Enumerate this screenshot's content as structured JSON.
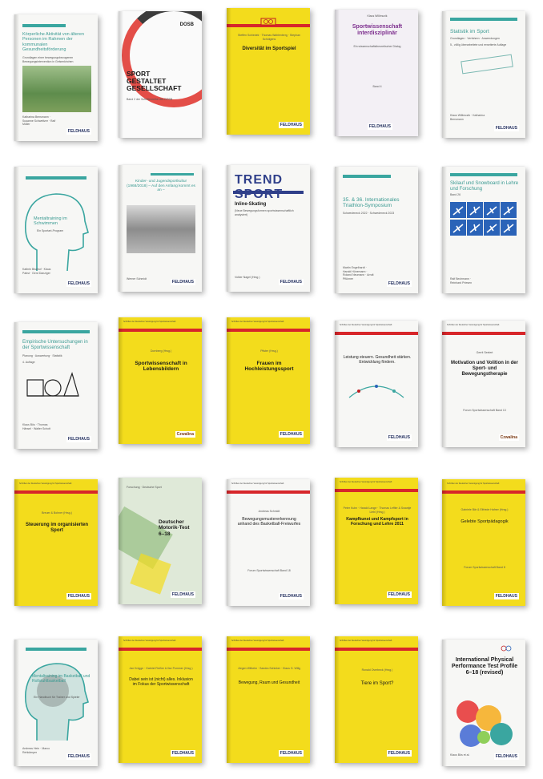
{
  "books": [
    {
      "title": "Körperliche Aktivität von älteren Personen im Rahmen der kommunalen Gesundheitsförderung",
      "subtitle": "Grundlagen einer bewegungsbezogenen Bewegungsintervention in Gelsenkirchen",
      "authors": "Katharina Bensmann · Susanne Schweitzer · Ralf Müller",
      "publisher": "FELDHAUS"
    },
    {
      "brand": "DOSB",
      "title": "SPORT GESTALTET GESELLSCHAFT",
      "subtitle": "Band 2 der Schriftenreihe des DOSB"
    },
    {
      "authors": "Steffen Schiedek · Thomas Wahlenberg · Stephan Schütgens",
      "title": "Diversität im Sportspiel",
      "publisher": "FELDHAUS"
    },
    {
      "author_top": "Klaus Willimczik",
      "title": "Sportwissenschaft interdisziplinär",
      "subtitle": "Ein wissenschaftstheoretischer Dialog",
      "band": "Band 4",
      "publisher": "FELDHAUS"
    },
    {
      "title": "Statistik im Sport",
      "subtitle": "Grundlagen · Verfahren · Anwendungen",
      "edition": "5., völlig überarbeitete und erweiterte Auflage",
      "authors": "Klaus Willimczik · Katharina Bensmann",
      "publisher": "FELDHAUS"
    },
    {
      "title": "Mentaltraining im Schwimmen",
      "subtitle": "Ein Sportart-Program",
      "authors": "Kathrin Bischof · Klaus Pabst · Gerd Danziger",
      "publisher": "FELDHAUS"
    },
    {
      "title": "Kinder- und Jugendsportkultur (1968/2018) – Auf den Anfang kommt es an –",
      "authors": "Werner Schmidt",
      "publisher": "FELDHAUS"
    },
    {
      "brand": "TREND SPORT",
      "title": "Inline-Skating",
      "subtitle": "(Neue Bewegungsformen sportwissenschaftlich analysiert)",
      "authors": "Volker Nagel (Hrsg.)",
      "publisher": "FELDHAUS"
    },
    {
      "title": "35. & 36. Internationales Triathlon-Symposium",
      "subtitle": "Schwedeneck 2022 · Schwedeneck 2023",
      "authors": "Martin Engelhardt · Harald Hünemann · Roland Neumann · Arndt Pfützner",
      "publisher": "FELDHAUS"
    },
    {
      "title": "Skilauf und Snowboard in Lehre und Forschung",
      "band": "Band 26",
      "authors": "Ralf Bechmann · Reinhard Priesen",
      "publisher": "FELDHAUS"
    },
    {
      "title": "Empirische Untersuchungen in der Sportwissenschaft",
      "subtitle": "Planung · Auswertung · Statistik",
      "edition": "4. Auflage",
      "authors": "Klaus Bös · Thomas Hänsel · Walter Schott",
      "publisher": "FELDHAUS"
    },
    {
      "series": "Schriften der Deutschen Vereinigung für Sportwissenschaft",
      "authors": "Dornberg (Hrsg.)",
      "title": "Sportwissenschaft in Lebensbildern",
      "publisher": "Czwalina"
    },
    {
      "series": "Schriften der Deutschen Vereinigung für Sportwissenschaft",
      "authors": "Pfister (Hrsg.)",
      "title": "Frauen im Hochleistungssport",
      "publisher": "FELDHAUS"
    },
    {
      "series": "Schriften der Deutschen Vereinigung für Sportwissenschaft",
      "title": "Leistung steuern. Gesundheit stärken. Entwicklung fördern.",
      "publisher": "FELDHAUS"
    },
    {
      "series": "Schriften der Deutschen Vereinigung für Sportwissenschaft",
      "authors": "Gerrit Seelert",
      "title": "Motivation und Volition in der Sport- und Bewegungstherapie",
      "band": "Forum Sportwissenschaft Band 13",
      "publisher": "Czwalina"
    },
    {
      "series": "Schriften der Deutschen Vereinigung für Sportwissenschaft",
      "authors": "Breuer & Bohner (Hrsg.)",
      "title": "Steuerung im organisierten Sport",
      "publisher": "FELDHAUS"
    },
    {
      "brand": "Forschung · Deutsche Sport",
      "title": "Deutscher Motorik-Test 6–18",
      "publisher": "FELDHAUS"
    },
    {
      "series": "Schriften der Deutschen Vereinigung für Sportwissenschaft",
      "authors": "Andreas Schmidt",
      "title": "Bewegungsmustererkennung anhand des Basketball-Freiwurfes",
      "band": "Forum Sportwissenschaft Band 18",
      "publisher": "FELDHAUS"
    },
    {
      "series": "Schriften der Deutschen Vereinigung für Sportwissenschaft",
      "authors": "Peter Kuhn · Harald Lange · Thomas Leffler & Swantje Liebl (Hrsg.)",
      "title": "Kampfkunst und Kampfsport in Forschung und Lehre 2011",
      "publisher": "FELDHAUS"
    },
    {
      "series": "Schriften der Deutschen Vereinigung für Sportwissenschaft",
      "authors": "Gabriele Bär & Elfriede Hafner (Hrsg.)",
      "title": "Gelebte Sportpädagogik",
      "band": "Forum Sportwissenschaft Band 8",
      "publisher": "FELDHAUS"
    },
    {
      "title": "Mentaltraining im Basketball und Rollstuhlbasketball",
      "subtitle": "Ein Handbuch für Trainer und Spieler",
      "authors": "Andreas Hein · Marco Rehkämper",
      "publisher": "FELDHAUS"
    },
    {
      "series": "Schriften der Deutschen Vereinigung für Sportwissenschaft",
      "authors": "Jan Knigge · Gabriel Reißer & Ilse Pommer (Hrsg.)",
      "title": "Dabei sein ist (nicht) alles. Inklusion im Fokus der Sportwissenschaft",
      "publisher": "FELDHAUS"
    },
    {
      "series": "Schriften der Deutschen Vereinigung für Sportwissenschaft",
      "authors": "Jürgen Wilhelm · Sandra Schinker · Klaus G. Wilig",
      "title": "Bewegung, Raum und Gesundheit",
      "publisher": "FELDHAUS"
    },
    {
      "series": "Schriften der Deutschen Vereinigung für Sportwissenschaft",
      "authors": "Ronald Overbeck (Hrsg.)",
      "title": "Tiere im Sport?",
      "publisher": "FELDHAUS"
    },
    {
      "title": "International Physical Performance Test Profile 6–18 (revised)",
      "authors": "Klaus Bös et al.",
      "publisher": "FELDHAUS"
    }
  ],
  "colors": {
    "teal": "#3aa6a0",
    "yellow": "#f3dc1c",
    "red": "#d7262a",
    "purple": "#7d2f8e",
    "navy": "#1d2a5a"
  }
}
